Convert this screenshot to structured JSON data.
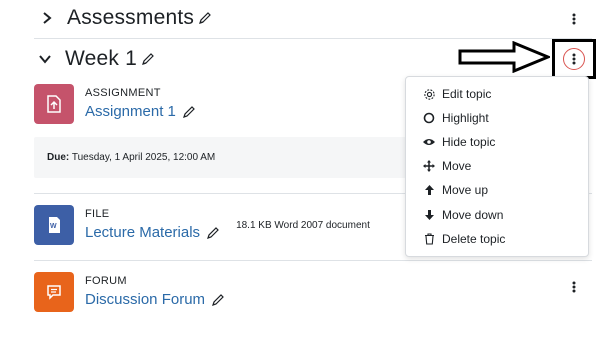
{
  "sections": {
    "assessments": {
      "title": "Assessments",
      "expanded": false
    },
    "week1": {
      "title": "Week 1",
      "expanded": true
    }
  },
  "activities": {
    "assignment": {
      "type": "ASSIGNMENT",
      "name": "Assignment 1",
      "icon": "assignment-icon",
      "color": "#c5536b",
      "due_label": "Due:",
      "due_value": "Tuesday, 1 April 2025, 12:00 AM"
    },
    "file": {
      "type": "FILE",
      "name": "Lecture Materials",
      "icon": "word-file-icon",
      "color": "#3d5fa6",
      "meta": "18.1 KB Word 2007 document"
    },
    "forum": {
      "type": "FORUM",
      "name": "Discussion Forum",
      "icon": "forum-icon",
      "color": "#e8641b"
    }
  },
  "menu": {
    "items": [
      {
        "label": "Edit topic",
        "icon": "gear-icon"
      },
      {
        "label": "Highlight",
        "icon": "circle-icon"
      },
      {
        "label": "Hide topic",
        "icon": "eye-icon"
      },
      {
        "label": "Move",
        "icon": "move-arrows-icon"
      },
      {
        "label": "Move up",
        "icon": "arrow-up-icon"
      },
      {
        "label": "Move down",
        "icon": "arrow-down-icon"
      },
      {
        "label": "Delete topic",
        "icon": "trash-icon"
      }
    ]
  },
  "colors": {
    "link": "#2b6aa8",
    "highlight_border": "#000000",
    "focus_circle": "#d9534f"
  }
}
